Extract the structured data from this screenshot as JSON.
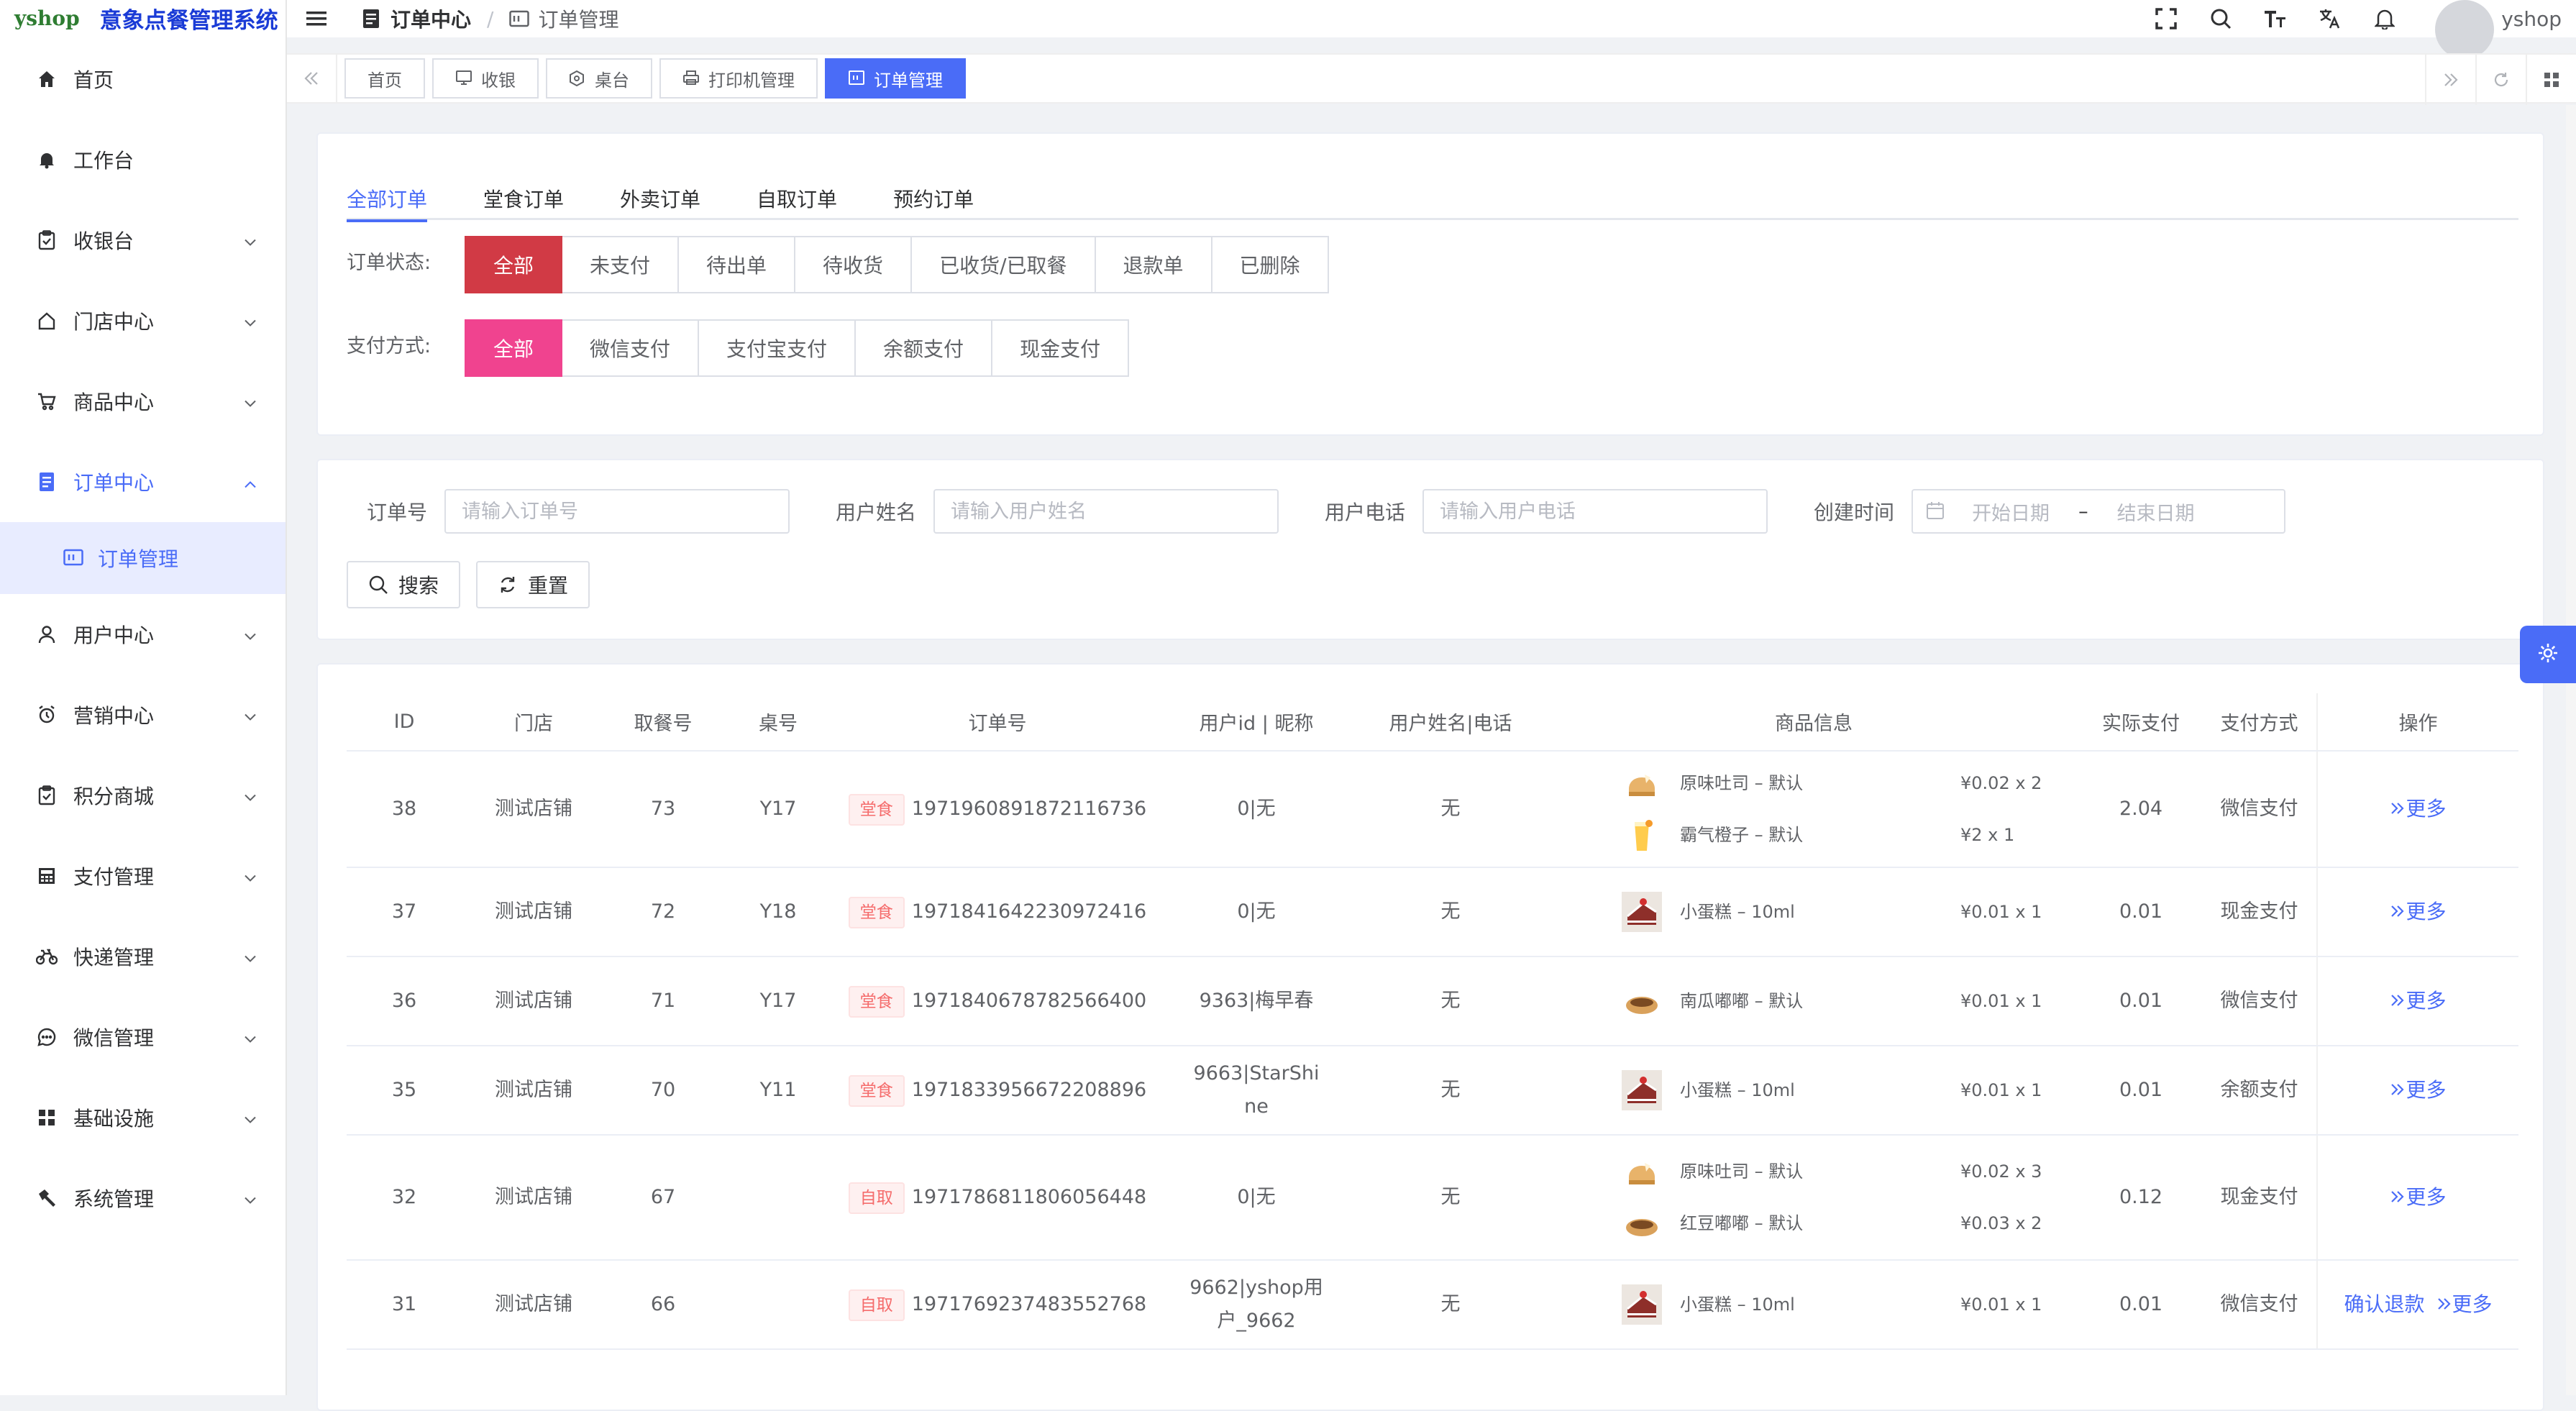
{
  "logo": {
    "mark": "yshop",
    "title": "意象点餐管理系统"
  },
  "sidebar": {
    "items": [
      {
        "label": "首页",
        "icon": "home-icon"
      },
      {
        "label": "工作台",
        "icon": "bell-icon"
      },
      {
        "label": "收银台",
        "icon": "clipboard-icon"
      },
      {
        "label": "门店中心",
        "icon": "house-icon"
      },
      {
        "label": "商品中心",
        "icon": "cart-icon"
      },
      {
        "label": "订单中心",
        "icon": "document-icon"
      },
      {
        "label": "用户中心",
        "icon": "user-icon"
      },
      {
        "label": "营销中心",
        "icon": "alarm-icon"
      },
      {
        "label": "积分商城",
        "icon": "clipboard-icon"
      },
      {
        "label": "支付管理",
        "icon": "calculator-icon"
      },
      {
        "label": "快递管理",
        "icon": "bicycle-icon"
      },
      {
        "label": "微信管理",
        "icon": "chat-icon"
      },
      {
        "label": "基础设施",
        "icon": "grid-icon"
      },
      {
        "label": "系统管理",
        "icon": "hammer-icon"
      }
    ],
    "sub_item": {
      "label": "订单管理",
      "icon": "table-icon"
    }
  },
  "header": {
    "breadcrumb": [
      "订单中心",
      "订单管理"
    ],
    "username": "yshop"
  },
  "tagsbar": {
    "tags": [
      {
        "label": "首页"
      },
      {
        "label": "收银"
      },
      {
        "label": "桌台"
      },
      {
        "label": "打印机管理"
      },
      {
        "label": "订单管理"
      }
    ]
  },
  "order_tabs": [
    "全部订单",
    "堂食订单",
    "外卖订单",
    "自取订单",
    "预约订单"
  ],
  "filters": {
    "status_label": "订单状态:",
    "status_options": [
      "全部",
      "未支付",
      "待出单",
      "待收货",
      "已收货/已取餐",
      "退款单",
      "已删除"
    ],
    "pay_label": "支付方式:",
    "pay_options": [
      "全部",
      "微信支付",
      "支付宝支付",
      "余额支付",
      "现金支付"
    ]
  },
  "search": {
    "order_no_label": "订单号",
    "order_no_placeholder": "请输入订单号",
    "user_name_label": "用户姓名",
    "user_name_placeholder": "请输入用户姓名",
    "user_phone_label": "用户电话",
    "user_phone_placeholder": "请输入用户电话",
    "created_label": "创建时间",
    "start_date": "开始日期",
    "date_sep": "–",
    "end_date": "结束日期",
    "search_btn": "搜索",
    "reset_btn": "重置"
  },
  "table": {
    "columns": [
      "ID",
      "门店",
      "取餐号",
      "桌号",
      "订单号",
      "用户id | 昵称",
      "用户姓名|电话",
      "商品信息",
      "实际支付",
      "支付方式",
      "操作"
    ],
    "rows": [
      {
        "id": "38",
        "store": "测试店铺",
        "pickup": "73",
        "table": "Y17",
        "type": "堂食",
        "order_no": "1971960891872116736",
        "user": "0|无",
        "name_phone": "无",
        "products": [
          {
            "name": "原味吐司 – 默认",
            "price": "¥0.02 x 2",
            "thumb": "toast"
          },
          {
            "name": "霸气橙子 – 默认",
            "price": "¥2 x 1",
            "thumb": "drink"
          }
        ],
        "paid": "2.04",
        "pay_method": "微信支付",
        "ops": [
          "更多"
        ]
      },
      {
        "id": "37",
        "store": "测试店铺",
        "pickup": "72",
        "table": "Y18",
        "type": "堂食",
        "order_no": "1971841642230972416",
        "user": "0|无",
        "name_phone": "无",
        "products": [
          {
            "name": "小蛋糕 – 10ml",
            "price": "¥0.01 x 1",
            "thumb": "cake"
          }
        ],
        "paid": "0.01",
        "pay_method": "现金支付",
        "ops": [
          "更多"
        ]
      },
      {
        "id": "36",
        "store": "测试店铺",
        "pickup": "71",
        "table": "Y17",
        "type": "堂食",
        "order_no": "1971840678782566400",
        "user": "9363|梅早春",
        "name_phone": "无",
        "products": [
          {
            "name": "南瓜嘟嘟 – 默认",
            "price": "¥0.01 x 1",
            "thumb": "bun"
          }
        ],
        "paid": "0.01",
        "pay_method": "微信支付",
        "ops": [
          "更多"
        ]
      },
      {
        "id": "35",
        "store": "测试店铺",
        "pickup": "70",
        "table": "Y11",
        "type": "堂食",
        "order_no": "1971833956672208896",
        "user": "9663|StarShine",
        "name_phone": "无",
        "products": [
          {
            "name": "小蛋糕 – 10ml",
            "price": "¥0.01 x 1",
            "thumb": "cake"
          }
        ],
        "paid": "0.01",
        "pay_method": "余额支付",
        "ops": [
          "更多"
        ]
      },
      {
        "id": "32",
        "store": "测试店铺",
        "pickup": "67",
        "table": "",
        "type": "自取",
        "order_no": "1971786811806056448",
        "user": "0|无",
        "name_phone": "无",
        "products": [
          {
            "name": "原味吐司 – 默认",
            "price": "¥0.02 x 3",
            "thumb": "toast"
          },
          {
            "name": "红豆嘟嘟 – 默认",
            "price": "¥0.03 x 2",
            "thumb": "bun"
          }
        ],
        "paid": "0.12",
        "pay_method": "现金支付",
        "ops": [
          "更多"
        ]
      },
      {
        "id": "31",
        "store": "测试店铺",
        "pickup": "66",
        "table": "",
        "type": "自取",
        "order_no": "1971769237483552768",
        "user": "9662|yshop用户_9662",
        "name_phone": "无",
        "products": [
          {
            "name": "小蛋糕 – 10ml",
            "price": "¥0.01 x 1",
            "thumb": "cake"
          }
        ],
        "paid": "0.01",
        "pay_method": "微信支付",
        "ops": [
          "确认退款",
          "更多"
        ]
      }
    ]
  },
  "colors": {
    "accent": "#4a6cf7",
    "status_active": "#d13a45",
    "pay_active": "#f0438f"
  }
}
